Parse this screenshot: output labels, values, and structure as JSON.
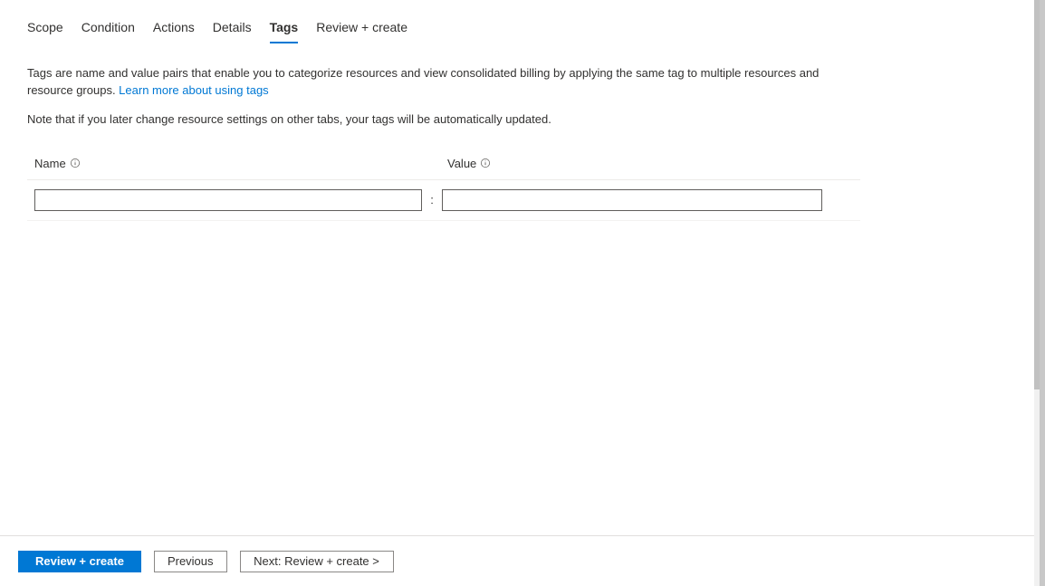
{
  "tabs": [
    {
      "label": "Scope"
    },
    {
      "label": "Condition"
    },
    {
      "label": "Actions"
    },
    {
      "label": "Details"
    },
    {
      "label": "Tags"
    },
    {
      "label": "Review + create"
    }
  ],
  "active_tab_index": 4,
  "description_text": "Tags are name and value pairs that enable you to categorize resources and view consolidated billing by applying the same tag to multiple resources and resource groups. ",
  "learn_more_link": "Learn more about using tags",
  "note_text": "Note that if you later change resource settings on other tabs, your tags will be automatically updated.",
  "columns": {
    "name_label": "Name",
    "value_label": "Value",
    "separator": ":"
  },
  "row": {
    "name_value": "",
    "value_value": ""
  },
  "footer": {
    "review_create": "Review + create",
    "previous": "Previous",
    "next": "Next: Review + create >"
  }
}
